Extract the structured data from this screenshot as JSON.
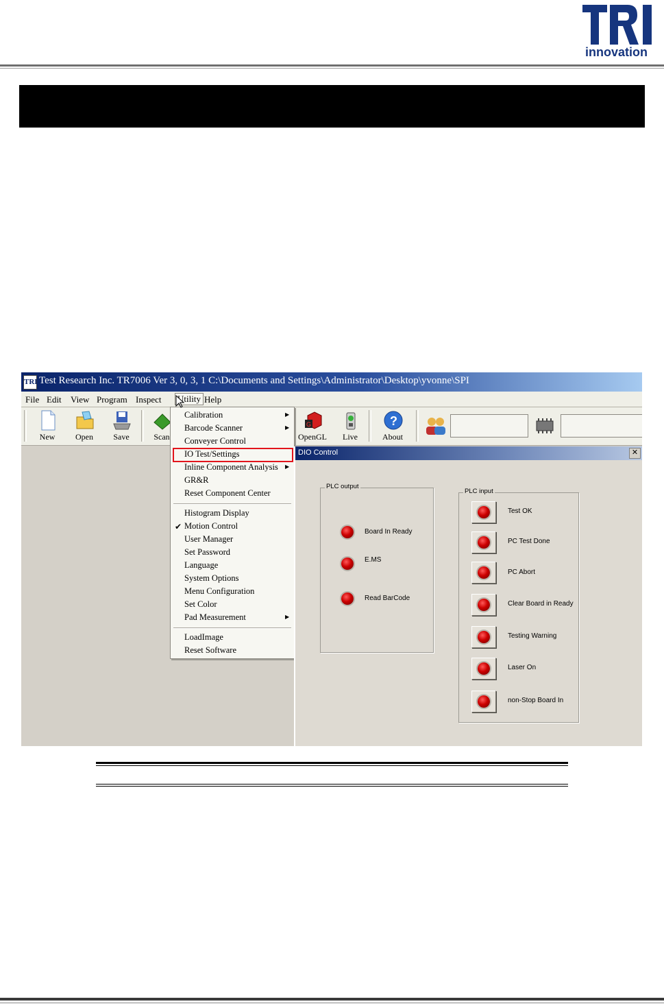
{
  "logo": {
    "mark": "TRI",
    "word": "innovation",
    "color": "#16357e"
  },
  "app": {
    "title": "Test Research Inc. TR7006 Ver 3, 0, 3, 1     C:\\Documents and Settings\\Administrator\\Desktop\\yvonne\\SPI",
    "icon_label": "TRI",
    "menu": [
      "File",
      "Edit",
      "View",
      "Program",
      "Inspect",
      "Utility",
      "Help"
    ],
    "toolbar": [
      {
        "label": "New",
        "icon": "new-document-icon"
      },
      {
        "label": "Open",
        "icon": "open-folder-icon"
      },
      {
        "label": "Save",
        "icon": "save-icon"
      },
      {
        "label": "Scan",
        "icon": "scan-icon"
      },
      {
        "label": "OpenGL",
        "icon": "opengl-icon"
      },
      {
        "label": "Live",
        "icon": "live-camera-icon"
      },
      {
        "label": "About",
        "icon": "help-icon"
      }
    ]
  },
  "utility_menu": {
    "items": [
      "Calibration",
      "Barcode Scanner",
      "Conveyer Control",
      "IO Test/Settings",
      "Inline Component Analysis",
      "GR&R",
      "Reset Component Center",
      "Histogram Display",
      "Motion Control",
      "User Manager",
      "Set Password",
      "Language",
      "System Options",
      "Menu Configuration",
      "Set Color",
      "Pad Measurement",
      "LoadImage",
      "Reset Software"
    ],
    "checked": "Motion Control",
    "highlighted": "IO Test/Settings",
    "highlight_color": "#e2141c"
  },
  "dio_dialog": {
    "title": "DIO Control",
    "close_label": "✕",
    "plc_output": {
      "title": "PLC output",
      "items": [
        "Board In Ready",
        "E.MS",
        "Read BarCode"
      ]
    },
    "plc_input": {
      "title": "PLC input",
      "items": [
        "Test OK",
        "PC Test Done",
        "PC Abort",
        "Clear Board in Ready",
        "Testing Warning",
        "Laser On",
        "non-Stop Board In"
      ]
    },
    "led_color": "#cc0000"
  }
}
